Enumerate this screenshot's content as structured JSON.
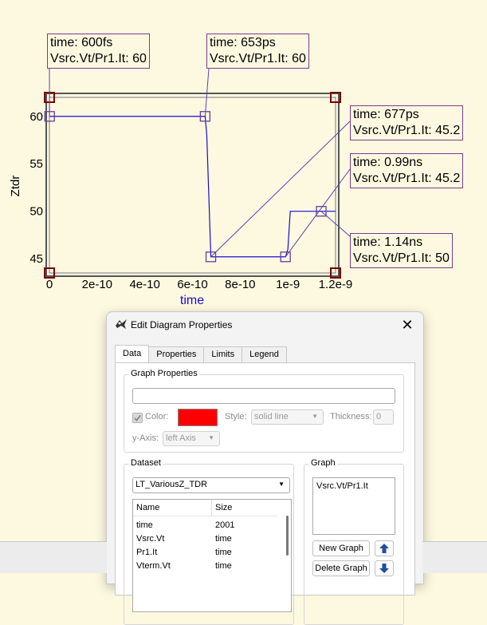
{
  "chart_data": {
    "type": "line",
    "xlabel": "time",
    "ylabel": "Ztdr",
    "xlim": [
      0,
      1.2e-09
    ],
    "ylim": [
      43.5,
      62
    ],
    "x_ticks": [
      {
        "value": 0,
        "label": "0"
      },
      {
        "value": 2e-10,
        "label": "2e-10"
      },
      {
        "value": 4e-10,
        "label": "4e-10"
      },
      {
        "value": 6e-10,
        "label": "6e-10"
      },
      {
        "value": 8e-10,
        "label": "8e-10"
      },
      {
        "value": 1e-09,
        "label": "1e-9"
      },
      {
        "value": 1.2e-09,
        "label": "1.2e-9"
      }
    ],
    "y_ticks": [
      {
        "value": 45,
        "label": "45"
      },
      {
        "value": 50,
        "label": "50"
      },
      {
        "value": 55,
        "label": "55"
      },
      {
        "value": 60,
        "label": "60"
      }
    ],
    "grid": true,
    "series": [
      {
        "color": "#1a0ccd",
        "x": [
          6e-13,
          6.53e-10,
          6.6e-10,
          6.77e-10,
          7e-10,
          9.9e-10,
          1e-09,
          1.01e-09,
          1.14e-09,
          1.2e-09
        ],
        "y": [
          60,
          60,
          58,
          45.2,
          45.2,
          45.2,
          46,
          50,
          50,
          50
        ]
      }
    ],
    "markers": [
      {
        "x": 6e-13,
        "y": 60,
        "line1": "time: 600fs",
        "line2": "Vsrc.Vt/Pr1.It: 60"
      },
      {
        "x": 6.53e-10,
        "y": 60,
        "line1": "time: 653ps",
        "line2": "Vsrc.Vt/Pr1.It: 60"
      },
      {
        "x": 6.77e-10,
        "y": 45.2,
        "line1": "time: 677ps",
        "line2": "Vsrc.Vt/Pr1.It: 45.2"
      },
      {
        "x": 9.9e-10,
        "y": 45.2,
        "line1": "time: 0.99ns",
        "line2": "Vsrc.Vt/Pr1.It: 45.2"
      },
      {
        "x": 1.14e-09,
        "y": 50,
        "line1": "time: 1.14ns",
        "line2": "Vsrc.Vt/Pr1.It: 50"
      }
    ]
  },
  "dialog": {
    "title": "Edit Diagram Properties",
    "close_glyph": "✕",
    "tabs": [
      "Data",
      "Properties",
      "Limits",
      "Legend"
    ],
    "graph_properties": {
      "group_label": "Graph Properties",
      "expression_value": "",
      "color_label": "Color:",
      "color_value": "#ff0000",
      "style_label": "Style:",
      "style_value": "solid line",
      "thickness_label": "Thickness:",
      "thickness_value": "0",
      "yaxis_label": "y-Axis:",
      "yaxis_value": "left Axis"
    },
    "dataset": {
      "group_label": "Dataset",
      "selected": "LT_VariousZ_TDR",
      "columns": [
        "Name",
        "Size"
      ],
      "rows": [
        {
          "name": "time",
          "size": "2001"
        },
        {
          "name": "Vsrc.Vt",
          "size": "time"
        },
        {
          "name": "Pr1.It",
          "size": "time"
        },
        {
          "name": "Vterm.Vt",
          "size": "time"
        }
      ]
    },
    "graph": {
      "group_label": "Graph",
      "items": [
        "Vsrc.Vt/Pr1.It"
      ],
      "new_graph_label": "New Graph",
      "delete_graph_label": "Delete Graph"
    }
  }
}
